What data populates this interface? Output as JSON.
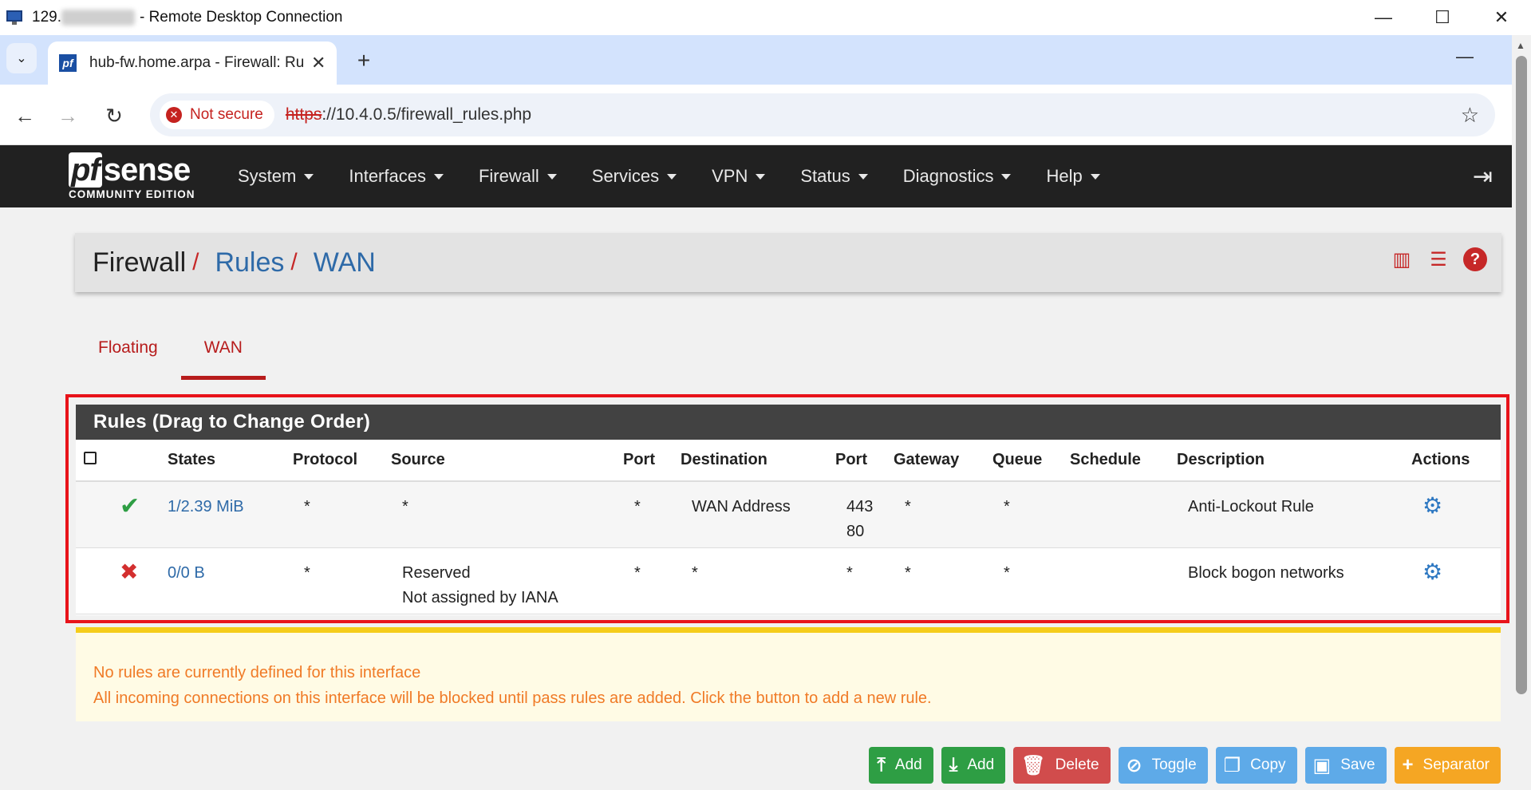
{
  "rdp": {
    "title_prefix": "129.",
    "title_suffix": "- Remote Desktop Connection",
    "min": "—",
    "max": "☐",
    "close": "✕"
  },
  "browser": {
    "tab_title": "hub-fw.home.arpa - Firewall: Rules",
    "favicon": "pf",
    "new_tab": "+",
    "security_label": "Not secure",
    "url_scheme": "https",
    "url_rest": "://10.4.0.5/firewall_rules.php"
  },
  "navbar": {
    "logo_main": "sense",
    "logo_pf": "pf",
    "logo_sub": "COMMUNITY EDITION",
    "menu": [
      {
        "label": "System"
      },
      {
        "label": "Interfaces"
      },
      {
        "label": "Firewall"
      },
      {
        "label": "Services"
      },
      {
        "label": "VPN"
      },
      {
        "label": "Status"
      },
      {
        "label": "Diagnostics"
      },
      {
        "label": "Help"
      }
    ]
  },
  "breadcrumb": {
    "part1": "Firewall",
    "part2": "Rules",
    "part3": "WAN",
    "sep": "/"
  },
  "tabs": [
    {
      "label": "Floating",
      "active": false
    },
    {
      "label": "WAN",
      "active": true
    }
  ],
  "rules": {
    "heading": "Rules (Drag to Change Order)",
    "columns": {
      "states": "States",
      "protocol": "Protocol",
      "source": "Source",
      "port": "Port",
      "destination": "Destination",
      "dport": "Port",
      "gateway": "Gateway",
      "queue": "Queue",
      "schedule": "Schedule",
      "description": "Description",
      "actions": "Actions"
    },
    "rows": [
      {
        "status_icon": "✔",
        "states": "1/2.39 MiB",
        "protocol": "*",
        "source": "*",
        "source2": "",
        "port": "*",
        "destination": "WAN Address",
        "dport": "443",
        "dport2": "80",
        "gateway": "*",
        "queue": "*",
        "schedule": "",
        "description": "Anti-Lockout Rule"
      },
      {
        "status_icon": "✖",
        "states": "0/0 B",
        "protocol": "*",
        "source": "Reserved",
        "source2": "Not assigned by IANA",
        "port": "*",
        "destination": "*",
        "dport": "*",
        "dport2": "",
        "gateway": "*",
        "queue": "*",
        "schedule": "",
        "description": "Block bogon networks"
      }
    ]
  },
  "warning": {
    "line1": "No rules are currently defined for this interface",
    "line2": "All incoming connections on this interface will be blocked until pass rules are added. Click the button to add a new rule."
  },
  "buttons": {
    "add_top": "Add",
    "add_bottom": "Add",
    "delete": "Delete",
    "toggle": "Toggle",
    "copy": "Copy",
    "save": "Save",
    "separator": "Separator"
  },
  "colors": {
    "navbar": "#212121",
    "accent_red": "#b71c1c",
    "link_blue": "#2e6aa8",
    "highlight": "#e8131a",
    "warning_text": "#f07a26"
  }
}
